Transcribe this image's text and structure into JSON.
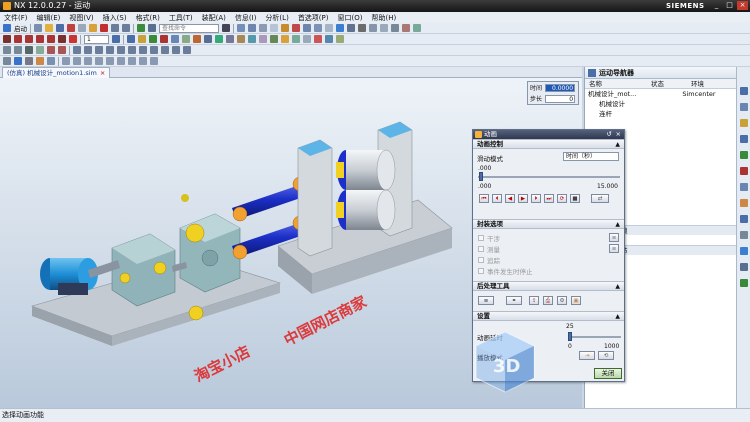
{
  "window": {
    "title": "NX 12.0.0.27 - 运动",
    "brand": "SIEMENS",
    "controls": [
      "_",
      "□",
      "×"
    ]
  },
  "menu": [
    "文件(F)",
    "编辑(E)",
    "视图(V)",
    "插入(S)",
    "格式(R)",
    "工具(T)",
    "装配(A)",
    "信息(I)",
    "分析(L)",
    "首选项(P)",
    "窗口(O)",
    "帮助(H)"
  ],
  "toolbar": {
    "start_label": "启动",
    "search_placeholder": "查找命令",
    "layer_value": "1"
  },
  "tab": {
    "label": "(仿真) 机械设计_motion1.sim",
    "close": "×"
  },
  "time_box": {
    "time_label": "时间",
    "time_value": "0.0000",
    "step_label": "步长",
    "step_value": "0"
  },
  "navigator": {
    "title": "运动导航器",
    "columns": [
      "名称",
      "状态",
      "环境"
    ],
    "rows": [
      {
        "name": "机械设计_mot...",
        "state": "",
        "env": "Simcenter"
      },
      {
        "name": "机械设计",
        "state": "",
        "env": ""
      },
      {
        "name": "连杆",
        "state": "",
        "env": ""
      },
      {
        "name": "",
        "state": "",
        "env": ""
      },
      {
        "name": "",
        "state": "",
        "env": ""
      },
      {
        "name": "",
        "state": "",
        "env": ""
      },
      {
        "name": "",
        "state": "",
        "env": ""
      },
      {
        "name": "",
        "state": "",
        "env": ""
      },
      {
        "name": "",
        "state": "",
        "env": ""
      },
      {
        "name": "",
        "state": "",
        "env": ""
      },
      {
        "name": "",
        "state": "",
        "env": ""
      }
    ],
    "section_a": "赖",
    "section_b": "节"
  },
  "animation_dialog": {
    "title": "动画",
    "group_control": "动画控制",
    "slide_mode_label": "滑动模式",
    "slide_mode_value": "时间（秒）",
    "start_value": ".000",
    "min_value": ".000",
    "max_value": "15.000",
    "group_package": "封装选项",
    "package_options": [
      "干涉",
      "测量",
      "追踪",
      "事件发生时停止"
    ],
    "group_post": "后处理工具",
    "group_settings": "设置",
    "delay_label": "动画延时",
    "delay_value": "25",
    "delay_min": "0",
    "delay_max": "1000",
    "play_mode_label": "播放模式",
    "close_button": "关闭"
  },
  "watermarks": [
    "淘宝小店",
    "中国网店商家"
  ],
  "logo_text": "3D",
  "status": "选择动画功能",
  "colors": {
    "accent": "#1f59b8",
    "motor_blue": "#1f8fd6",
    "shaft_blue": "#1c2fc8",
    "frame_gray": "#c9ced4",
    "gear_yellow": "#f0d020"
  }
}
